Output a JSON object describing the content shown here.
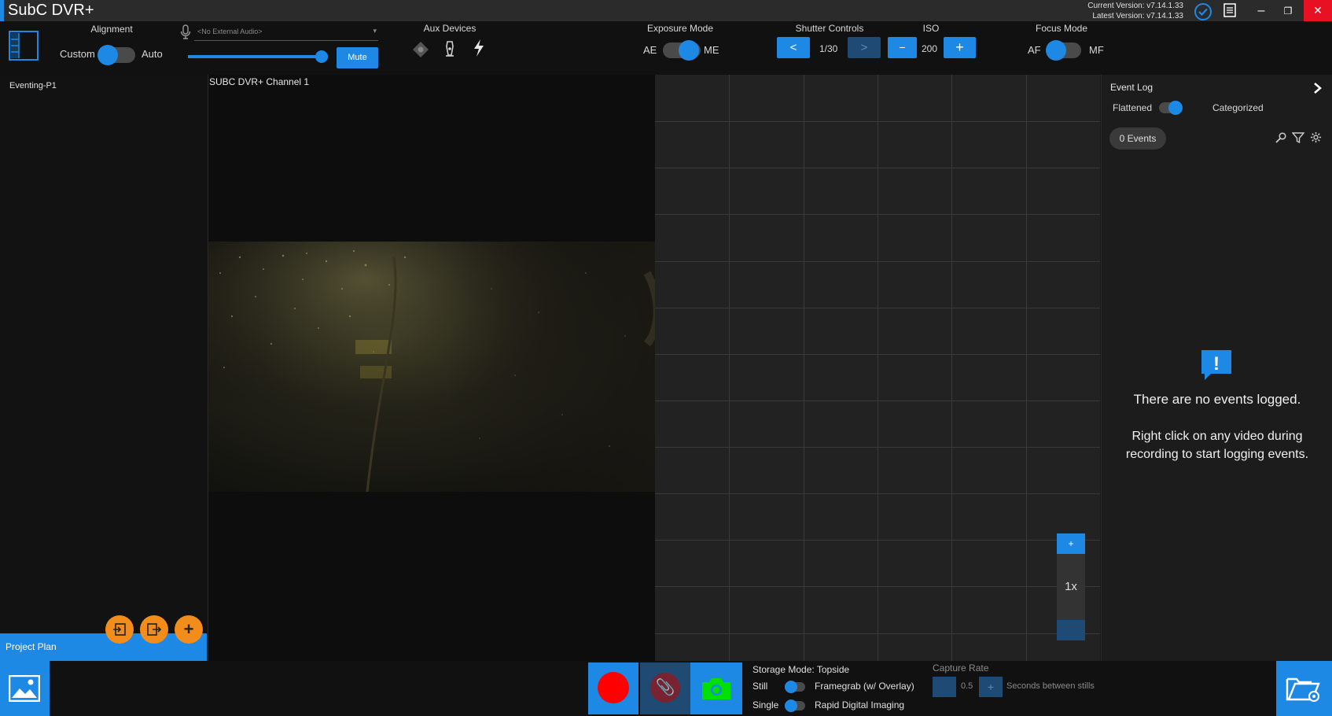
{
  "app": {
    "title": "SubC DVR+",
    "current_version": "Current Version: v7.14.1.33",
    "latest_version": "Latest Version: v7.14.1.33"
  },
  "toolbar": {
    "alignment": {
      "label": "Alignment",
      "left": "Custom",
      "right": "Auto"
    },
    "audio": {
      "placeholder": "<No External Audio>",
      "mute_label": "Mute",
      "volume_percent": 100
    },
    "aux_devices": {
      "label": "Aux Devices"
    },
    "exposure": {
      "label": "Exposure Mode",
      "left": "AE",
      "right": "ME"
    },
    "shutter": {
      "label": "Shutter Controls",
      "prev": "<",
      "value": "1/30",
      "next": ">"
    },
    "iso": {
      "label": "ISO",
      "minus": "−",
      "value": "200",
      "plus": "+"
    },
    "focus": {
      "label": "Focus Mode",
      "left": "AF",
      "right": "MF"
    }
  },
  "left_panel": {
    "project_name": "Eventing-P1",
    "project_plan_label": "Project Plan",
    "add_label": "+"
  },
  "video": {
    "channel_label": "SUBC DVR+ Channel 1"
  },
  "grid": {
    "zoom_plus": "+",
    "zoom_level": "1x"
  },
  "event_log": {
    "title": "Event Log",
    "view_left": "Flattened",
    "view_right": "Categorized",
    "events_count": "0  Events",
    "empty_title": "There are no events logged.",
    "empty_hint": "Right click on any video during recording to start logging events.",
    "alert_glyph": "!"
  },
  "bottom": {
    "storage_mode": "Storage Mode: Topside",
    "still_label": "Still",
    "framegrab_label": "Framegrab (w/ Overlay)",
    "single_label": "Single",
    "rdi_label": "Rapid Digital Imaging",
    "capture_rate_label": "Capture Rate",
    "capture_rate_value": "0.5",
    "capture_rate_unit": "Seconds between stills"
  },
  "colors": {
    "accent": "#1e88e5",
    "record": "#ff0000",
    "camera": "#00e000",
    "orange": "#f28c1a",
    "close": "#e81123"
  }
}
